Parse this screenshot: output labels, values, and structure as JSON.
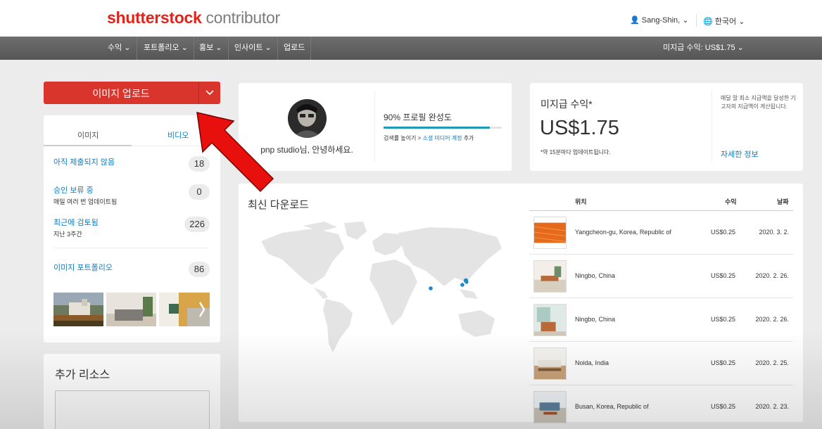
{
  "header": {
    "logo_brand": "shutterstock",
    "logo_sub": "contributor",
    "user": "Sang-Shin,",
    "language": "한국어"
  },
  "nav": {
    "items": [
      "수익",
      "포트폴리오",
      "홍보",
      "인사이트",
      "업로드"
    ],
    "unpaid": "미지급 수익: US$1.75"
  },
  "upload": {
    "label": "이미지 업로드"
  },
  "left": {
    "tabs": [
      "이미지",
      "비디오"
    ],
    "stats": [
      {
        "label": "아직 제출되지 않음",
        "sub": "",
        "count": "18"
      },
      {
        "label": "승인 보류 중",
        "sub": "매일 여러 번 업데이트됨",
        "count": "0"
      },
      {
        "label": "최근에 검토됨",
        "sub": "지난 3주간",
        "count": "226"
      },
      {
        "label": "이미지 포트폴리오",
        "sub": "",
        "count": "86"
      }
    ]
  },
  "resources": {
    "title": "추가 리소스"
  },
  "profile": {
    "greeting": "pnp studio님, 안녕하세요.",
    "completion_label": "90% 프로필 완성도",
    "completion": 0.9,
    "hint_prefix": "검색률 높이기 > ",
    "hint_link": "소셜 미디어 계정",
    "hint_suffix": " 추가"
  },
  "earnings": {
    "title": "미지급 수익*",
    "amount": "US$1.75",
    "note": "*약 15분마다 업데이트됩니다.",
    "description": "매달 말 최소 지급액을 달성한 기고자의 지급액이 게산됩니다.",
    "more": "자세한 정보"
  },
  "downloads": {
    "title": "최신 다운로드",
    "headers": {
      "location": "위치",
      "earnings": "수익",
      "date": "날짜"
    },
    "rows": [
      {
        "location": "Yangcheon-gu, Korea, Republic of",
        "amount": "US$0.25",
        "date": "2020. 3. 2."
      },
      {
        "location": "Ningbo, China",
        "amount": "US$0.25",
        "date": "2020. 2. 26."
      },
      {
        "location": "Ningbo, China",
        "amount": "US$0.25",
        "date": "2020. 2. 26."
      },
      {
        "location": "Noida, India",
        "amount": "US$0.25",
        "date": "2020. 2. 25."
      },
      {
        "location": "Busan, Korea, Republic of",
        "amount": "US$0.25",
        "date": "2020. 2. 23."
      }
    ]
  },
  "colors": {
    "accent": "#d9352c",
    "link": "#0f7cbf",
    "progress": "#1d9bb8",
    "map_dot": "#1d8ac7"
  }
}
